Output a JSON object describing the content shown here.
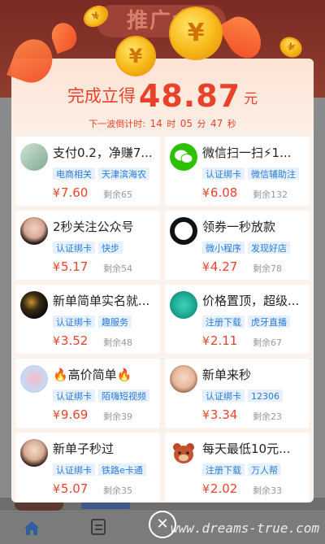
{
  "background": {
    "banner_title": "推广大"
  },
  "modal": {
    "reward": {
      "prefix": "完成立得",
      "amount": "48.87",
      "unit": "元"
    },
    "countdown": {
      "label": "下一波倒计时:",
      "hours": "14",
      "hours_unit": "时",
      "minutes": "05",
      "minutes_unit": "分",
      "seconds": "47",
      "seconds_unit": "秒"
    },
    "tasks": [
      {
        "title": "支付0.2，净赚7...",
        "tags": [
          "电商相关",
          "天津滨海农"
        ],
        "currency": "¥",
        "price": "7.60",
        "remain": "剩余65",
        "avatar": "scenery-avatar"
      },
      {
        "title": "微信扫一扫⚡1...",
        "tags": [
          "认证绑卡",
          "微信辅助注"
        ],
        "currency": "¥",
        "price": "6.08",
        "remain": "剩余132",
        "avatar": "wechat-avatar"
      },
      {
        "title": "2秒关注公众号",
        "tags": [
          "认证绑卡",
          "快步"
        ],
        "currency": "¥",
        "price": "5.17",
        "remain": "剩余54",
        "avatar": "girl-avatar"
      },
      {
        "title": "领券一秒放款",
        "tags": [
          "微小程序",
          "发现好店"
        ],
        "currency": "¥",
        "price": "4.27",
        "remain": "剩余78",
        "avatar": "cartoon-avatar"
      },
      {
        "title": "新单简单实名就...",
        "tags": [
          "认证绑卡",
          "趣服务"
        ],
        "currency": "¥",
        "price": "3.52",
        "remain": "剩余48",
        "avatar": "dark-avatar"
      },
      {
        "title": "价格置顶，超级...",
        "tags": [
          "注册下载",
          "虎牙直播"
        ],
        "currency": "¥",
        "price": "2.11",
        "remain": "剩余67",
        "avatar": "teal-avatar"
      },
      {
        "title": "🔥高价简单🔥",
        "tags": [
          "认证绑卡",
          "陌嗨短视频"
        ],
        "currency": "¥",
        "price": "9.69",
        "remain": "剩余39",
        "avatar": "heart-avatar"
      },
      {
        "title": "新单来秒",
        "tags": [
          "认证绑卡",
          "12306"
        ],
        "currency": "¥",
        "price": "3.34",
        "remain": "剩余23",
        "avatar": "child-avatar"
      },
      {
        "title": "新单子秒过",
        "tags": [
          "认证绑卡",
          "铁路e卡通"
        ],
        "currency": "¥",
        "price": "5.07",
        "remain": "剩余35",
        "avatar": "woman-avatar"
      },
      {
        "title": "每天最低10元...",
        "tags": [
          "注册下载",
          "万人帮"
        ],
        "currency": "¥",
        "price": "2.02",
        "remain": "剩余33",
        "avatar": "bear-avatar"
      }
    ]
  },
  "coin_symbol": "¥",
  "close_symbol": "✕",
  "watermark": "www.dreams-true.com",
  "colors": {
    "accent_red": "#e8432a",
    "tag_blue": "#2a7bd8",
    "tag_bg": "#e6f1fd",
    "coin_gold": "#f7b919"
  }
}
